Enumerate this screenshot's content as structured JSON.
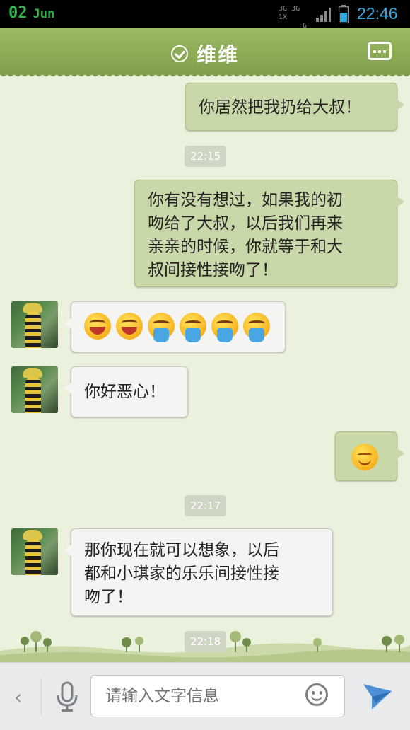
{
  "status_bar": {
    "day": "02",
    "month": "Jun",
    "network_top": "3G 3G 1X",
    "network_bottom": "G",
    "time": "22:46"
  },
  "header": {
    "title": "维维",
    "status_icon": "check-circle-icon",
    "menu_icon": "more-options-icon"
  },
  "messages": [
    {
      "type": "outgoing",
      "text": "你居然把我扔给大叔！"
    },
    {
      "type": "timestamp",
      "text": "22:15"
    },
    {
      "type": "outgoing",
      "lines": [
        "你有没有想过，如果我的初",
        "吻给了大叔，以后我们再来",
        "亲亲的时候，你就等于和大",
        "叔间接性接吻了！"
      ]
    },
    {
      "type": "incoming",
      "emoji": [
        "laughing-emoji",
        "laughing-emoji",
        "vomiting-emoji",
        "vomiting-emoji",
        "vomiting-emoji",
        "vomiting-emoji"
      ]
    },
    {
      "type": "incoming",
      "text": "你好恶心！"
    },
    {
      "type": "outgoing",
      "emoji": [
        "smirk-emoji"
      ]
    },
    {
      "type": "timestamp",
      "text": "22:17"
    },
    {
      "type": "incoming",
      "lines": [
        "那你现在就可以想象，以后",
        "都和小琪家的乐乐间接性接",
        "吻了！"
      ]
    },
    {
      "type": "timestamp",
      "text": "22:18"
    }
  ],
  "input_bar": {
    "placeholder": "请输入文字信息",
    "icons": [
      "chevron-left-icon",
      "microphone-icon",
      "emoji-icon",
      "send-icon"
    ]
  },
  "colors": {
    "title_bar": "#89a853",
    "chat_background": "#eaf1dc",
    "outgoing_bubble": "#c9d8a9",
    "incoming_bubble": "#f4f4f2",
    "status_time": "#35a9e0",
    "status_date": "#2fb44a"
  }
}
